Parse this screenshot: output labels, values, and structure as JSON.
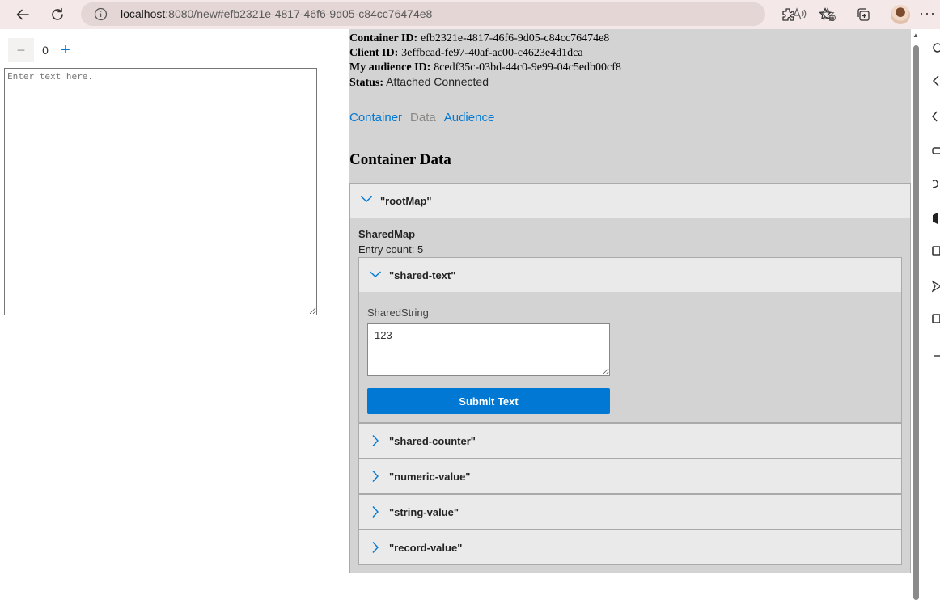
{
  "browser": {
    "url_host": "localhost",
    "url_rest": ":8080/new#efb2321e-4817-46f6-9d05-c84cc76474e8"
  },
  "counter": {
    "decrement": "−",
    "value": "0",
    "increment": "+"
  },
  "editor": {
    "placeholder": "Enter text here."
  },
  "devtools": {
    "container_id_label": "Container ID:",
    "container_id": "efb2321e-4817-46f6-9d05-c84cc76474e8",
    "client_id_label": "Client ID:",
    "client_id": "3effbcad-fe97-40af-ac00-c4623e4d1dca",
    "audience_id_label": "My audience ID:",
    "audience_id": "8cedf35c-03bd-44c0-9e99-04c5edb00cf8",
    "status_label": "Status:",
    "status": "Attached Connected",
    "tabs": [
      {
        "label": "Container"
      },
      {
        "label": "Data"
      },
      {
        "label": "Audience"
      }
    ],
    "section_title": "Container Data",
    "root_map": {
      "key": "\"rootMap\"",
      "type": "SharedMap",
      "entry_count": "Entry count: 5",
      "entries": [
        {
          "key": "\"shared-text\"",
          "type": "SharedString",
          "value": "123",
          "submit_label": "Submit Text"
        },
        {
          "key": "\"shared-counter\""
        },
        {
          "key": "\"numeric-value\""
        },
        {
          "key": "\"string-value\""
        },
        {
          "key": "\"record-value\""
        }
      ]
    }
  },
  "colors": {
    "accent": "#0078d4",
    "pane_bg": "#d3d3d3",
    "header_bg": "#eaeaea",
    "browser_bg": "#f5e8e8"
  }
}
